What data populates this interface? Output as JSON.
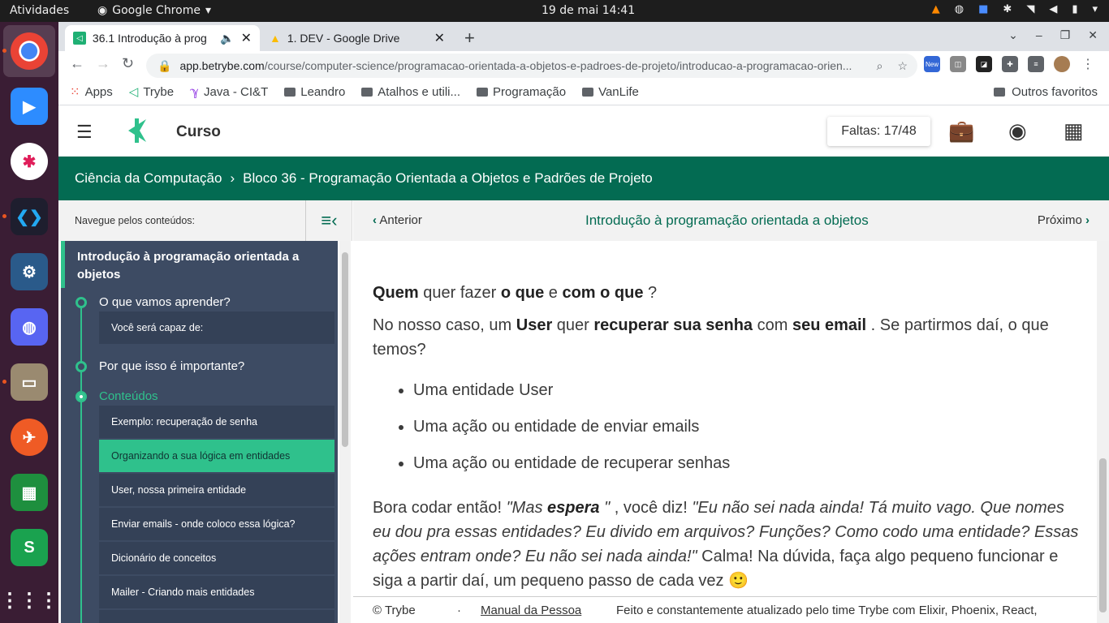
{
  "os_bar": {
    "activities": "Atividades",
    "app": "Google Chrome",
    "clock": "19 de mai  14:41"
  },
  "tabs": [
    {
      "title": "36.1 Introdução à prog"
    },
    {
      "title": "1. DEV - Google Drive"
    }
  ],
  "address": {
    "host": "app.betrybe.com",
    "path": "/course/computer-science/programacao-orientada-a-objetos-e-padroes-de-projeto/introducao-a-programacao-orien..."
  },
  "extensions": {
    "new_badge": "New"
  },
  "bookmarks": [
    {
      "label": "Apps"
    },
    {
      "label": "Trybe"
    },
    {
      "label": "Java - CI&T"
    },
    {
      "label": "Leandro"
    },
    {
      "label": "Atalhos e utili..."
    },
    {
      "label": "Programação"
    },
    {
      "label": "VanLife"
    }
  ],
  "bookmarks_other": "Outros favoritos",
  "header": {
    "title": "Curso",
    "faltas": "Faltas: 17/48"
  },
  "breadcrumb": {
    "level1": "Ciência da Computação",
    "sep": "›",
    "level2": "Bloco 36 - Programação Orientada a Objetos e Padrões de Projeto"
  },
  "sidebar": {
    "nav_label": "Navegue pelos conteúdos:",
    "module_title": "Introdução à programação orientada a objetos",
    "sections": [
      {
        "label": "O que vamos aprender?"
      },
      {
        "label": "Por que isso é importante?"
      },
      {
        "label": "Conteúdos"
      }
    ],
    "subitems": [
      {
        "label": "Você será capaz de:"
      },
      {
        "label": "Exemplo: recuperação de senha"
      },
      {
        "label": "Organizando a sua lógica em entidades"
      },
      {
        "label": "User, nossa primeira entidade"
      },
      {
        "label": "Enviar emails - onde coloco essa lógica?"
      },
      {
        "label": "Dicionário de conceitos"
      },
      {
        "label": "Mailer - Criando mais entidades"
      }
    ]
  },
  "page_nav": {
    "prev": "Anterior",
    "title": "Introdução à programação orientada a objetos",
    "next": "Próximo"
  },
  "content": {
    "p1": {
      "a": "Quem",
      "b": " quer fazer ",
      "c": "o que",
      "d": " e ",
      "e": "com o que",
      "f": " ?"
    },
    "p2": {
      "a": "No nosso caso, um ",
      "b": "User",
      "c": " quer ",
      "d": "recuperar sua senha",
      "e": " com ",
      "f": "seu email",
      "g": " . Se partirmos daí, o que temos?"
    },
    "list": [
      "Uma entidade User",
      "Uma ação ou entidade de enviar emails",
      "Uma ação ou entidade de recuperar senhas"
    ],
    "p3": {
      "a": "Bora codar então! ",
      "b": "\"Mas ",
      "c": "espera",
      "d": " \"",
      "e": " , você diz! ",
      "f": "\"Eu não sei nada ainda! Tá muito vago. Que nomes eu dou pra essas entidades? Eu divido em arquivos? Funções? Como codo uma entidade? Essas ações entram onde? Eu não sei nada ainda!\"",
      "g": " Calma! Na dúvida, faça algo pequeno funcionar e siga a partir daí, um pequeno passo de cada vez 🙂"
    }
  },
  "footer": {
    "copyright": "© Trybe",
    "dot": "·",
    "manual": "Manual da Pessoa",
    "credits": "Feito e constantemente atualizado pelo time Trybe com Elixir, Phoenix, React,"
  }
}
